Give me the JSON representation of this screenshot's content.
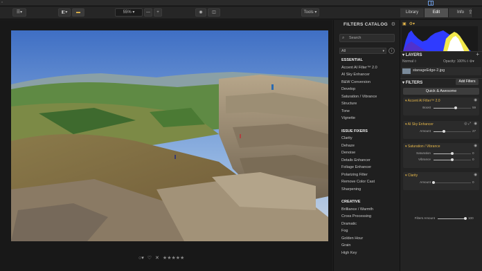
{
  "toolbar": {
    "zoom": "55%",
    "zoom_minus": "—",
    "zoom_plus": "+",
    "tools_label": "Tools"
  },
  "tabs": [
    {
      "label": "Library",
      "active": false
    },
    {
      "label": "Edit",
      "active": true
    },
    {
      "label": "Info",
      "active": false
    }
  ],
  "catalog": {
    "title": "FILTERS CATALOG",
    "search_placeholder": "Search",
    "category_select": "All",
    "sections": [
      {
        "title": "ESSENTIAL",
        "items": [
          "Accent AI Filter™ 2.0",
          "AI Sky Enhancer",
          "B&W Conversion",
          "Develop",
          "Saturation / Vibrance",
          "Structure",
          "Tone",
          "Vignette"
        ]
      },
      {
        "title": "ISSUE FIXERS",
        "items": [
          "Clarity",
          "Dehaze",
          "Denoise",
          "Details Enhancer",
          "Foliage Enhancer",
          "Polarizing Filter",
          "Remove Color Cast",
          "Sharpening"
        ]
      },
      {
        "title": "CREATIVE",
        "items": [
          "Brilliance / Warmth",
          "Cross Processing",
          "Dramatic",
          "Fog",
          "Golden Hour",
          "Grain",
          "High Key"
        ]
      }
    ]
  },
  "panel": {
    "layers_title": "LAYERS",
    "blend_mode": "Normal",
    "opacity": "Opacity: 100%",
    "layer_name": "stanageEdge-2.jpg",
    "filters_title": "FILTERS",
    "add_filters": "Add Filters",
    "quick_awesome": "Quick & Awesome",
    "filters": [
      {
        "name": "Accent AI Filter™ 2.0",
        "sliders": [
          {
            "label": "Boost",
            "value": "59",
            "fraction": 0.59
          }
        ]
      },
      {
        "name": "AI Sky Enhancer",
        "sliders": [
          {
            "label": "Amount",
            "value": "27",
            "fraction": 0.27
          }
        ]
      },
      {
        "name": "Saturation / Vibrance",
        "sliders": [
          {
            "label": "Saturation",
            "value": "0",
            "fraction": 0.5
          },
          {
            "label": "Vibrance",
            "value": "0",
            "fraction": 0.5
          }
        ]
      },
      {
        "name": "Clarity",
        "sliders": [
          {
            "label": "Amount",
            "value": "0",
            "fraction": 0.0
          }
        ]
      }
    ],
    "filters_amount_label": "Filters Amount",
    "filters_amount_value": "100",
    "filters_amount_fraction": 1.0
  },
  "colors": {
    "accent": "#e4b64a",
    "histogram_blue": "#2f3bff",
    "histogram_yellow": "#f2e84a",
    "histogram_white": "#ffffff"
  }
}
